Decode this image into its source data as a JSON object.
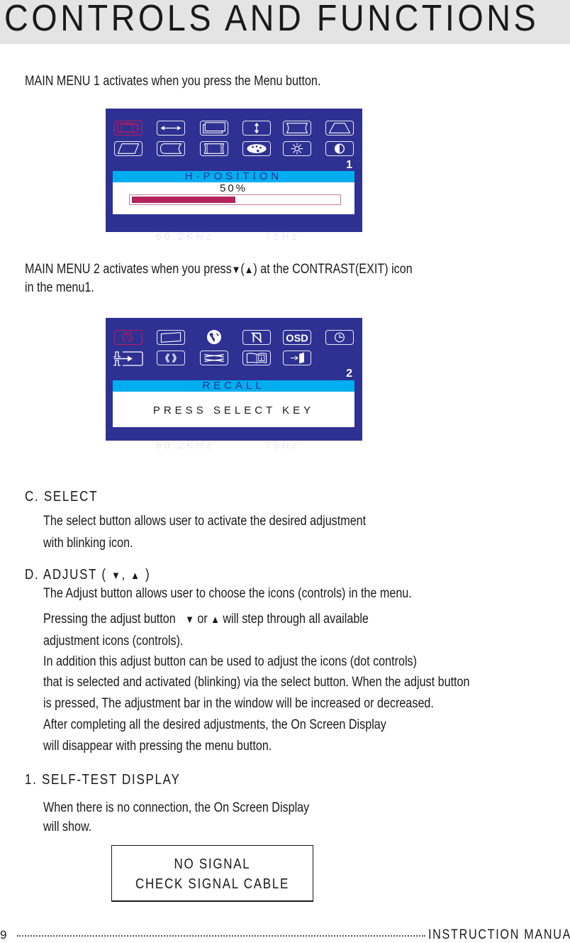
{
  "page": {
    "title": "CONTROLS AND FUNCTIONS",
    "page_number": "9",
    "footer_title": "INSTRUCTION MANUAL"
  },
  "intro": {
    "menu1_text": "MAIN MENU 1 activates when you press the Menu button.",
    "menu2_text_a": "MAIN MENU 2 activates when you press",
    "menu2_down": "▼",
    "menu2_open": "(",
    "menu2_up": "▲",
    "menu2_text_b": ") at the CONTRAST(EXIT) icon",
    "menu2_text_c": "in the menu1."
  },
  "osd1": {
    "icons": [
      "h-v-size",
      "h-position",
      "h-size",
      "v-position",
      "pincushion",
      "trapezoid",
      "parallelogram",
      "pin-balance",
      "side-pincushion",
      "color",
      "brightness",
      "contrast"
    ],
    "selected_icon": "h-v-size",
    "menu_number": "1",
    "label": "H-POSITION",
    "value_text": "50%",
    "value_percent": 50,
    "h_freq": "60.2KHz",
    "v_freq": "75Hz"
  },
  "osd2": {
    "icons": [
      "recall",
      "rotation",
      "language",
      "degauss",
      "osd-position",
      "osd-timeout",
      "input-select",
      "moire",
      "convergence",
      "information",
      "exit"
    ],
    "selected_icon": "recall",
    "menu_number": "2",
    "label": "RECALL",
    "message": "PRESS SELECT KEY",
    "h_freq": "60.2KHz",
    "v_freq": "75Hz"
  },
  "select_section": {
    "heading": "C. SELECT",
    "lines": [
      "The select button allows user to activate the desired adjustment",
      "with blinking icon."
    ]
  },
  "adjust_section": {
    "heading_a": "D. ADJUST (",
    "heading_down": "▼",
    "heading_comma": ",",
    "heading_up": "▲",
    "heading_b": ")",
    "line1": "The Adjust button allows user to choose the icons (controls) in the menu.",
    "line2_a": "Pressing the adjust button",
    "line2_down": "▼",
    "line2_or": "or",
    "line2_up": "▲",
    "line2_b": "will step through all available",
    "lines_rest": [
      "adjustment icons (controls).",
      "In addition this adjust button can be used to adjust the icons (dot controls)",
      "that is selected and activated (blinking) via the select button. When the adjust button",
      "is pressed, The adjustment bar in the window will be increased or decreased.",
      "After completing all the desired adjustments, the On Screen Display",
      "will disappear with pressing the menu button."
    ]
  },
  "selftest_section": {
    "heading": "1. SELF-TEST DISPLAY",
    "lines": [
      "When there is no connection, the On Screen Display",
      "will show."
    ],
    "box_line1": "NO SIGNAL",
    "box_line2": "CHECK SIGNAL CABLE"
  },
  "colors": {
    "osd_background": "#2e3192",
    "osd_title_bar": "#00aeef",
    "progress_fill": "#b5235e",
    "selected_icon": "#c2185b",
    "title_band": "#e4e4e4"
  }
}
